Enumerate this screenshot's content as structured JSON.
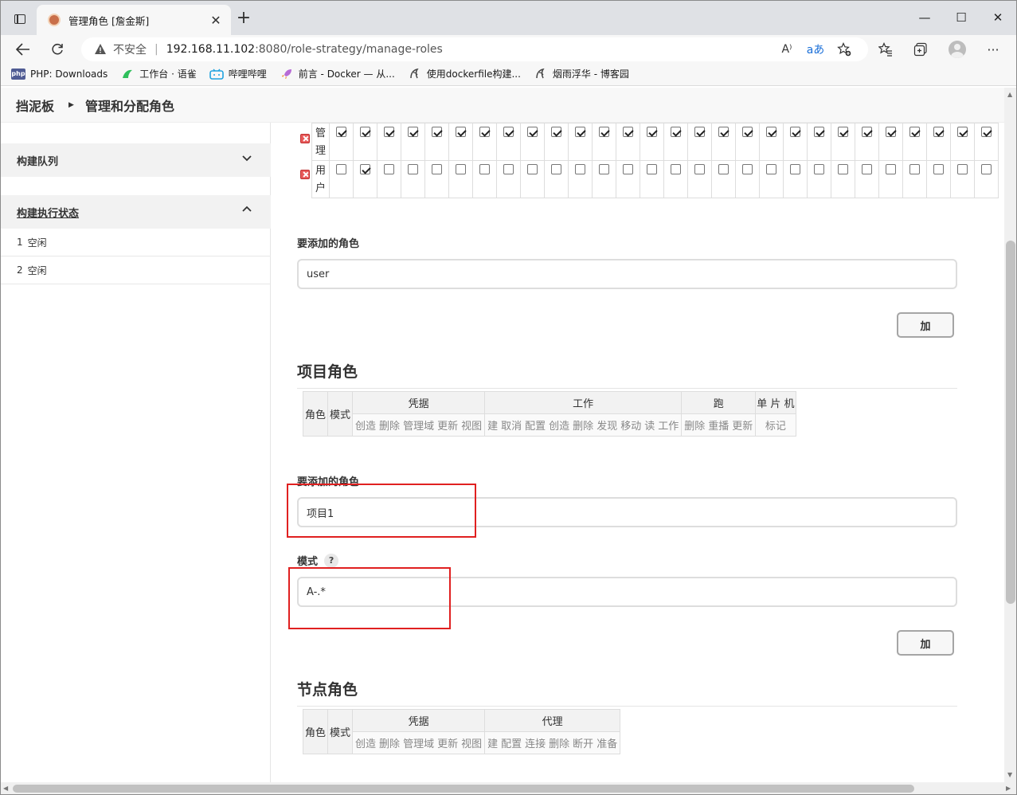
{
  "browser": {
    "tab_title": "管理角色 [詹金斯]",
    "tab_close": "✕",
    "new_tab": "+",
    "window_controls": {
      "minimize": "—",
      "maximize": "☐",
      "close": "✕"
    },
    "insecure_label": "不安全",
    "url_host": "192.168.11.102",
    "url_path": ":8080/role-strategy/manage-roles",
    "read_aloud": "A⁾",
    "translate": "aあ",
    "bookmarks": [
      {
        "icon": "php-icon",
        "label": "PHP: Downloads"
      },
      {
        "icon": "yuque-icon",
        "label": "工作台 · 语雀"
      },
      {
        "icon": "bilibili-icon",
        "label": "哔哩哔哩"
      },
      {
        "icon": "rocket-icon",
        "label": "前言 - Docker — 从..."
      },
      {
        "icon": "cnblogs-icon",
        "label": "使用dockerfile构建..."
      },
      {
        "icon": "cnblogs-icon",
        "label": "烟雨浮华 - 博客园"
      }
    ]
  },
  "breadcrumb": {
    "dashboard": "挡泥板",
    "separator": "▶",
    "current": "管理和分配角色"
  },
  "sidebar": {
    "build_queue": "构建队列",
    "executor_status": "构建执行状态",
    "executors": [
      {
        "num": "1",
        "state": "空闲"
      },
      {
        "num": "2",
        "state": "空闲"
      }
    ]
  },
  "global_roles": {
    "rows": [
      {
        "name_line1": "管",
        "name_line2": "理",
        "checked": [
          true,
          true,
          true,
          true,
          true,
          true,
          true,
          true,
          true,
          true,
          true,
          true,
          true,
          true,
          true,
          true,
          true,
          true,
          true,
          true,
          true,
          true,
          true,
          true,
          true,
          true,
          true,
          true
        ]
      },
      {
        "name_line1": "用",
        "name_line2": "户",
        "checked": [
          false,
          true,
          false,
          false,
          false,
          false,
          false,
          false,
          false,
          false,
          false,
          false,
          false,
          false,
          false,
          false,
          false,
          false,
          false,
          false,
          false,
          false,
          false,
          false,
          false,
          false,
          false,
          false
        ]
      }
    ],
    "role_to_add_label": "要添加的角色",
    "role_to_add_value": "user",
    "add_button": "加"
  },
  "project_roles": {
    "title": "项目角色",
    "table": {
      "role": "角色",
      "pattern": "模式",
      "groups": [
        {
          "name": "凭据",
          "perms": [
            "创造",
            "删除",
            "管理域",
            "更新",
            "视图"
          ]
        },
        {
          "name": "工作",
          "perms": [
            "建",
            "取消",
            "配置",
            "创造",
            "删除",
            "发现",
            "移动",
            "读",
            "工作"
          ]
        },
        {
          "name": "跑",
          "perms": [
            "删除",
            "重播",
            "更新"
          ]
        },
        {
          "name": "单 片 机",
          "perms": [
            "标记"
          ]
        }
      ]
    },
    "role_to_add_label": "要添加的角色",
    "role_to_add_value": "项目1",
    "pattern_label": "模式",
    "pattern_help": "?",
    "pattern_value": "A-.*",
    "add_button": "加"
  },
  "node_roles": {
    "title": "节点角色",
    "table": {
      "role": "角色",
      "pattern": "模式",
      "groups": [
        {
          "name": "凭据",
          "perms": [
            "创造",
            "删除",
            "管理域",
            "更新",
            "视图"
          ]
        },
        {
          "name": "代理",
          "perms": [
            "建",
            "配置",
            "连接",
            "删除",
            "断开",
            "准备"
          ]
        }
      ]
    }
  },
  "colors": {
    "highlight_box": "#e02020",
    "sidebar_header_bg": "#f2f2f2",
    "table_header_bg": "#f2f2f2"
  }
}
